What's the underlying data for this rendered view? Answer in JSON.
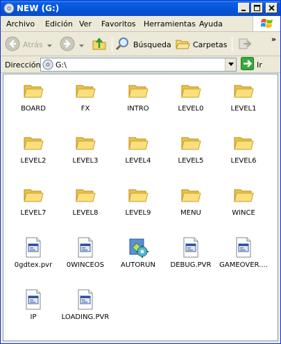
{
  "window": {
    "title": "NEW (G:)"
  },
  "menubar": {
    "items": [
      "Archivo",
      "Edición",
      "Ver",
      "Favoritos",
      "Herramientas",
      "Ayuda"
    ]
  },
  "toolbar": {
    "back_label": "Atrás",
    "search_label": "Búsqueda",
    "folders_label": "Carpetas",
    "overflow": "»"
  },
  "address": {
    "label": "Dirección",
    "value": "G:\\",
    "go_label": "Ir"
  },
  "files": [
    {
      "name": "BOARD",
      "type": "folder"
    },
    {
      "name": "FX",
      "type": "folder"
    },
    {
      "name": "INTRO",
      "type": "folder"
    },
    {
      "name": "LEVEL0",
      "type": "folder"
    },
    {
      "name": "LEVEL1",
      "type": "folder"
    },
    {
      "name": "LEVEL2",
      "type": "folder"
    },
    {
      "name": "LEVEL3",
      "type": "folder"
    },
    {
      "name": "LEVEL4",
      "type": "folder"
    },
    {
      "name": "LEVEL5",
      "type": "folder"
    },
    {
      "name": "LEVEL6",
      "type": "folder"
    },
    {
      "name": "LEVEL7",
      "type": "folder"
    },
    {
      "name": "LEVEL8",
      "type": "folder"
    },
    {
      "name": "LEVEL9",
      "type": "folder"
    },
    {
      "name": "MENU",
      "type": "folder"
    },
    {
      "name": "WINCE",
      "type": "folder"
    },
    {
      "name": "0gdtex.pvr",
      "type": "file"
    },
    {
      "name": "0WINCEOS",
      "type": "file"
    },
    {
      "name": "AUTORUN",
      "type": "autorun"
    },
    {
      "name": "DEBUG.PVR",
      "type": "file"
    },
    {
      "name": "GAMEOVER....",
      "type": "file"
    },
    {
      "name": "IP",
      "type": "file"
    },
    {
      "name": "LOADING.PVR",
      "type": "file"
    }
  ]
}
